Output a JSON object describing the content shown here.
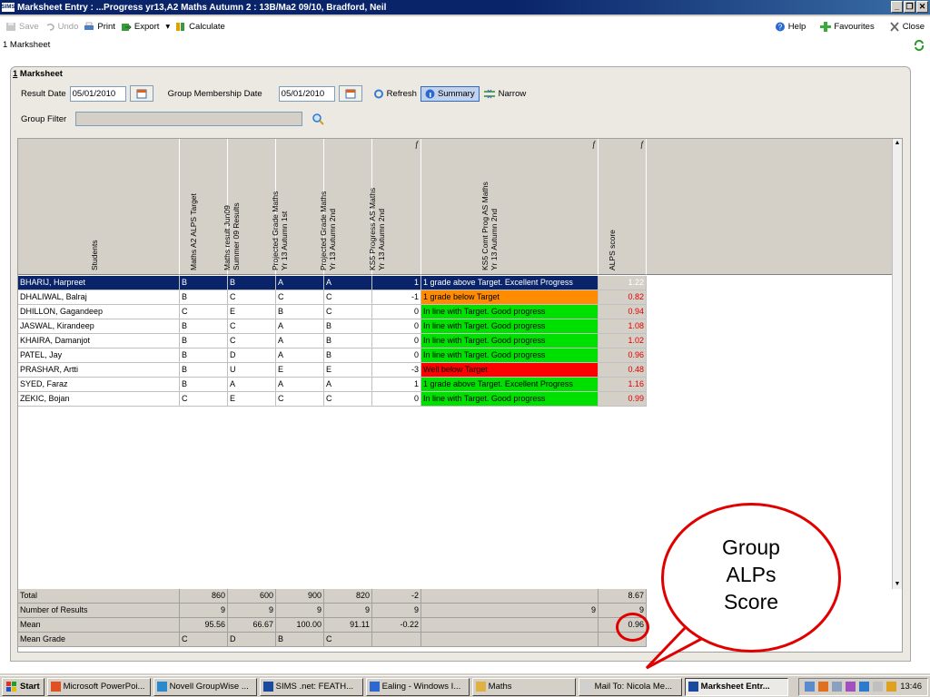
{
  "window": {
    "title": "Marksheet Entry : ...Progress yr13,A2 Maths Autumn 2 : 13B/Ma2 09/10, Bradford, Neil",
    "app_badge": "SIMS",
    "minimize": "_",
    "restore": "❐",
    "close": "✕"
  },
  "toolbar": {
    "save": "Save",
    "undo": "Undo",
    "print": "Print",
    "export": "Export",
    "export_arrow": "▾",
    "calculate": "Calculate",
    "help": "Help",
    "favourites": "Favourites",
    "close": "Close"
  },
  "breadcrumb": "1 Marksheet",
  "panel": {
    "title_num": "1",
    "title": " Marksheet",
    "result_date_label": "Result Date",
    "result_date": "05/01/2010",
    "group_membership_label": "Group Membership Date",
    "group_membership_date": "05/01/2010",
    "refresh": "Refresh",
    "summary": "Summary",
    "narrow": "Narrow",
    "group_filter_label": "Group Filter"
  },
  "columns": [
    {
      "label": "Students",
      "fx": ""
    },
    {
      "label": "Maths A2 ALPS Target",
      "fx": ""
    },
    {
      "label": "Maths result Jun09\nSummer 09 Results",
      "fx": ""
    },
    {
      "label": "Projected Grade Maths\nYr 13 Autumn 1st",
      "fx": ""
    },
    {
      "label": "Projected Grade Maths\nYr 13 Autumn 2nd",
      "fx": ""
    },
    {
      "label": "KS5 Progress AS Maths\nYr 13 Autumn 2nd",
      "fx": "f"
    },
    {
      "label": "KS5 Comt Prog AS Maths\nYr 13 Autumn 2nd",
      "fx": "f"
    },
    {
      "label": "ALPS score",
      "fx": "f"
    }
  ],
  "rows": [
    {
      "name": "BHARIJ, Harpreet",
      "target": "B",
      "jun09": "B",
      "aut1": "A",
      "aut2": "A",
      "prog": "1",
      "comment": "1 grade above Target. Excellent Progress",
      "comment_color": "#0a246a",
      "alps": "1.22",
      "selected": true
    },
    {
      "name": "DHALIWAL, Balraj",
      "target": "B",
      "jun09": "C",
      "aut1": "C",
      "aut2": "C",
      "prog": "-1",
      "comment": "1 grade below Target",
      "comment_color": "#ff8c00",
      "alps": "0.82"
    },
    {
      "name": "DHILLON, Gagandeep",
      "target": "C",
      "jun09": "E",
      "aut1": "B",
      "aut2": "C",
      "prog": "0",
      "comment": "In line with Target. Good progress",
      "comment_color": "#00e000",
      "alps": "0.94"
    },
    {
      "name": "JASWAL, Kirandeep",
      "target": "B",
      "jun09": "C",
      "aut1": "A",
      "aut2": "B",
      "prog": "0",
      "comment": "In line with Target. Good progress",
      "comment_color": "#00e000",
      "alps": "1.08"
    },
    {
      "name": "KHAIRA, Damanjot",
      "target": "B",
      "jun09": "C",
      "aut1": "A",
      "aut2": "B",
      "prog": "0",
      "comment": "In line with Target. Good progress",
      "comment_color": "#00e000",
      "alps": "1.02"
    },
    {
      "name": "PATEL, Jay",
      "target": "B",
      "jun09": "D",
      "aut1": "A",
      "aut2": "B",
      "prog": "0",
      "comment": "In line with Target. Good progress",
      "comment_color": "#00e000",
      "alps": "0.96"
    },
    {
      "name": "PRASHAR, Artti",
      "target": "B",
      "jun09": "U",
      "aut1": "E",
      "aut2": "E",
      "prog": "-3",
      "comment": "Well below Target",
      "comment_color": "#ff0000",
      "alps": "0.48"
    },
    {
      "name": "SYED, Faraz",
      "target": "B",
      "jun09": "A",
      "aut1": "A",
      "aut2": "A",
      "prog": "1",
      "comment": "1 grade above Target. Excellent Progress",
      "comment_color": "#00e000",
      "alps": "1.16"
    },
    {
      "name": "ZEKIC, Bojan",
      "target": "C",
      "jun09": "E",
      "aut1": "C",
      "aut2": "C",
      "prog": "0",
      "comment": "In line with Target. Good progress",
      "comment_color": "#00e000",
      "alps": "0.99"
    }
  ],
  "totals": [
    {
      "label": "Total",
      "target": "",
      "jun09": "860",
      "aut1": "600",
      "aut2": "900",
      "aut2b": "820",
      "prog": "-2",
      "comment": "",
      "alps": "8.67"
    },
    {
      "label": "Number of Results",
      "target": "9",
      "jun09": "9",
      "aut1": "9",
      "aut2": "9",
      "aut2b": "",
      "prog": "9",
      "comment": "9",
      "alps": "9"
    },
    {
      "label": "Mean",
      "target": "95.56",
      "jun09": "66.67",
      "aut1": "100.00",
      "aut2": "91.11",
      "aut2b": "",
      "prog": "-0.22",
      "comment": "",
      "alps": "0.96"
    },
    {
      "label": "Mean Grade",
      "target": "C",
      "jun09": "D",
      "aut1": "B",
      "aut2": "C",
      "aut2b": "",
      "prog": "",
      "comment": "",
      "alps": ""
    }
  ],
  "callout": {
    "line1": "Group",
    "line2": "ALPs",
    "line3": "Score"
  },
  "taskbar": {
    "start": "Start",
    "items": [
      "Microsoft PowerPoi...",
      "Novell GroupWise ...",
      "SIMS .net: FEATH...",
      "Ealing - Windows I...",
      "Maths",
      "Mail To: Nicola  Me...",
      "Marksheet Entr..."
    ],
    "clock": "13:46"
  },
  "colors": {
    "accent": "#0a246a",
    "good": "#00e000",
    "warn": "#ff8c00",
    "bad": "#ff0000",
    "callout": "#e00000"
  }
}
